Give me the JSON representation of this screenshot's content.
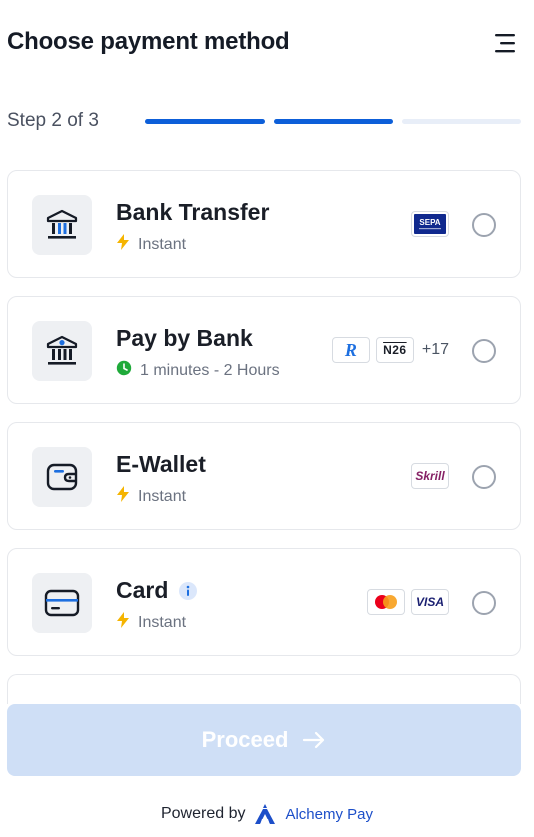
{
  "header": {
    "title": "Choose payment method",
    "menu_icon": "menu-icon"
  },
  "steps": {
    "label": "Step 2 of 3",
    "current": 2,
    "total": 3
  },
  "methods": [
    {
      "name": "Bank Transfer",
      "speed": "Instant",
      "speed_icon": "bolt-icon",
      "icon": "bank-icon",
      "badges": [
        "SEPA"
      ]
    },
    {
      "name": "Pay by Bank",
      "speed": "1 minutes - 2 Hours",
      "speed_icon": "clock-icon",
      "icon": "bank-euro-icon",
      "badges": [
        "R",
        "N26"
      ],
      "more": "+17"
    },
    {
      "name": "E-Wallet",
      "speed": "Instant",
      "speed_icon": "bolt-icon",
      "icon": "wallet-icon",
      "badges": [
        "Skrill"
      ]
    },
    {
      "name": "Card",
      "speed": "Instant",
      "speed_icon": "bolt-icon",
      "icon": "card-icon",
      "info_icon": "info-icon",
      "badges": [
        "mastercard",
        "VISA"
      ]
    }
  ],
  "proceed": {
    "label": "Proceed"
  },
  "footer": {
    "powered_by": "Powered by",
    "brand": "Alchemy Pay"
  },
  "colors": {
    "primary": "#0d5fd9",
    "proceed_disabled": "#cfdff6",
    "bolt": "#f5b400",
    "clock": "#1faa3a"
  }
}
